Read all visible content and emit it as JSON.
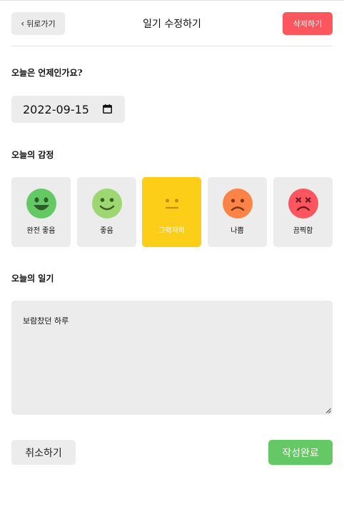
{
  "header": {
    "back_label": "뒤로가기",
    "title": "일기 수정하기",
    "delete_label": "삭제하기"
  },
  "date_section": {
    "title": "오늘은 언제인가요?",
    "date_value": "2022-09-15"
  },
  "emotion_section": {
    "title": "오늘의 감정",
    "selected_index": 2,
    "items": [
      {
        "label": "완전 좋음",
        "color": "#64c964",
        "icon": "very-happy-face-icon"
      },
      {
        "label": "좋음",
        "color": "#9dd772",
        "icon": "happy-face-icon"
      },
      {
        "label": "그럭저럭",
        "color": "#fdce17",
        "icon": "neutral-face-icon"
      },
      {
        "label": "나쁨",
        "color": "#fd8446",
        "icon": "sad-face-icon"
      },
      {
        "label": "끔찍함",
        "color": "#fd565f",
        "icon": "terrible-face-icon"
      }
    ]
  },
  "diary_section": {
    "title": "오늘의 일기",
    "content": "보람찼던 하루"
  },
  "footer": {
    "cancel_label": "취소하기",
    "submit_label": "작성완료"
  },
  "colors": {
    "accent_green": "#64c964",
    "accent_red": "#fd565f",
    "selected_yellow": "#fdce17",
    "panel_gray": "#ececec"
  }
}
